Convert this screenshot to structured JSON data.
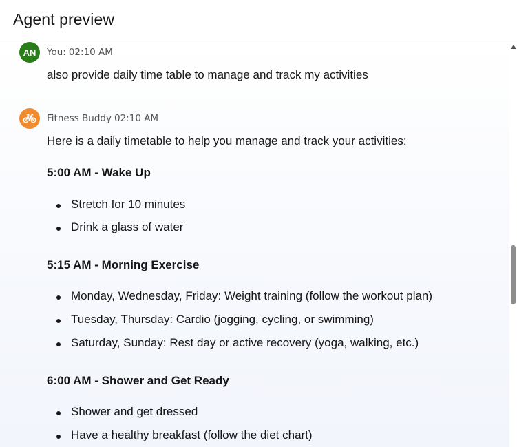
{
  "header": {
    "title": "Agent preview"
  },
  "messages": {
    "user": {
      "avatar_initials": "AN",
      "sender": "You:",
      "time": "02:10 AM",
      "text": "also provide daily time table to manage and track my activities",
      "avatar_color": "#2a7e19"
    },
    "bot": {
      "avatar_icon": "bicycle-icon",
      "sender": "Fitness Buddy",
      "time": "02:10 AM",
      "avatar_color": "#f28b2e",
      "intro": "Here is a daily timetable to help you manage and track your activities:",
      "sections": [
        {
          "heading": "5:00 AM - Wake Up",
          "items": [
            "Stretch for 10 minutes",
            "Drink a glass of water"
          ]
        },
        {
          "heading": "5:15 AM - Morning Exercise",
          "items": [
            "Monday, Wednesday, Friday: Weight training (follow the workout plan)",
            "Tuesday, Thursday: Cardio (jogging, cycling, or swimming)",
            "Saturday, Sunday: Rest day or active recovery (yoga, walking, etc.)"
          ]
        },
        {
          "heading": "6:00 AM - Shower and Get Ready",
          "items": [
            "Shower and get dressed",
            "Have a healthy breakfast (follow the diet chart)"
          ]
        }
      ]
    }
  }
}
